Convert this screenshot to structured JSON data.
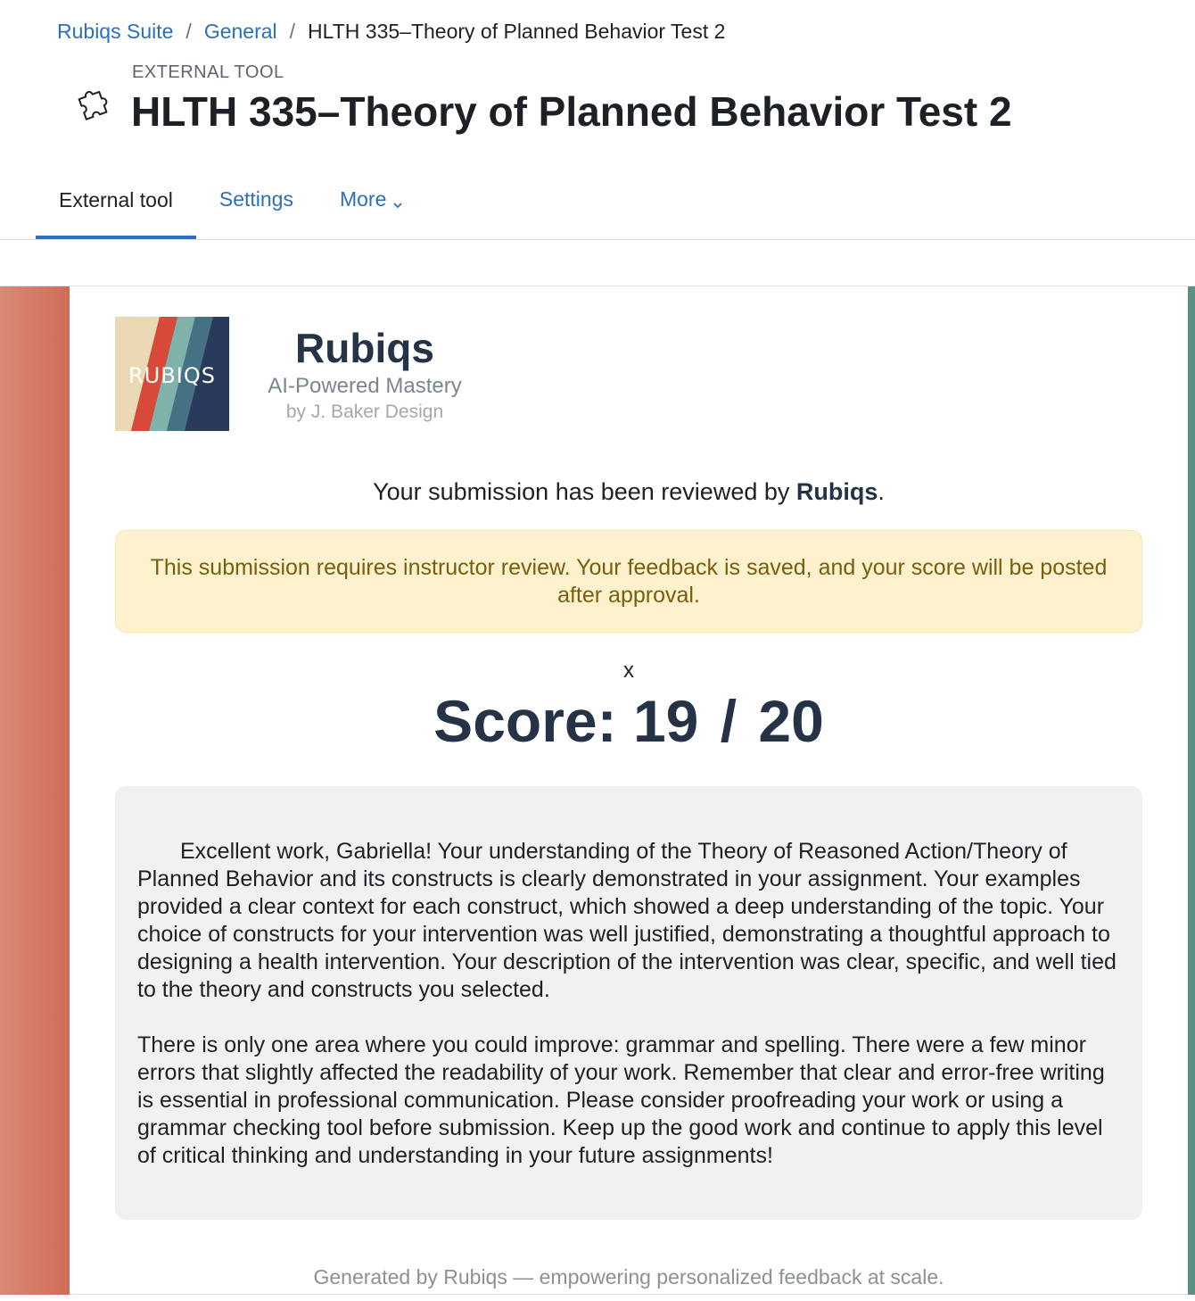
{
  "breadcrumb": {
    "items": [
      "Rubiqs Suite",
      "General"
    ],
    "current": "HLTH 335–Theory of Planned Behavior Test 2",
    "separator": "/"
  },
  "header": {
    "pre_title": "External tool",
    "title": "HLTH 335–Theory of Planned Behavior Test 2",
    "icon": "puzzle-icon"
  },
  "tabs": {
    "external_tool": "External tool",
    "settings": "Settings",
    "more": "More"
  },
  "tool": {
    "logo_text": "RUBIQS",
    "brand_name": "Rubiqs",
    "tagline": "AI-Powered Mastery",
    "byline": "by J. Baker Design",
    "review_prefix": "Your submission has been reviewed by ",
    "review_brand": "Rubiqs",
    "review_suffix": ".",
    "alert": "This submission requires instructor review. Your feedback is saved, and your score will be posted after approval.",
    "close_label": "x",
    "score_label": "Score:",
    "score_value": "19",
    "score_sep": "/",
    "score_total": "20",
    "feedback_p1": "Excellent work, Gabriella! Your understanding of the Theory of Reasoned Action/Theory of Planned Behavior and its constructs is clearly demonstrated in your assignment. Your examples provided a clear context for each construct, which showed a deep understanding of the topic. Your choice of constructs for your intervention was well justified, demonstrating a thoughtful approach to designing a health intervention. Your description of the intervention was clear, specific, and well tied to the theory and constructs you selected.",
    "feedback_p2": "There is only one area where you could improve: grammar and spelling. There were a few minor errors that slightly affected the readability of your work. Remember that clear and error-free writing is essential in professional communication. Please consider proofreading your work or using a grammar checking tool before submission. Keep up the good work and continue to apply this level of critical thinking and understanding in your future assignments!",
    "footer": "Generated by Rubiqs — empowering personalized feedback at scale."
  },
  "colors": {
    "link": "#2c6fbb",
    "brand_navy": "#253347",
    "alert_bg": "#fdf2cd",
    "alert_text": "#7a5e0e",
    "left_band": "#cf6c58",
    "right_band": "#5e8e86",
    "logo_stripes": [
      "#ead9b4",
      "#d9493a",
      "#7fb2aa",
      "#457184",
      "#2a3a5a"
    ]
  }
}
